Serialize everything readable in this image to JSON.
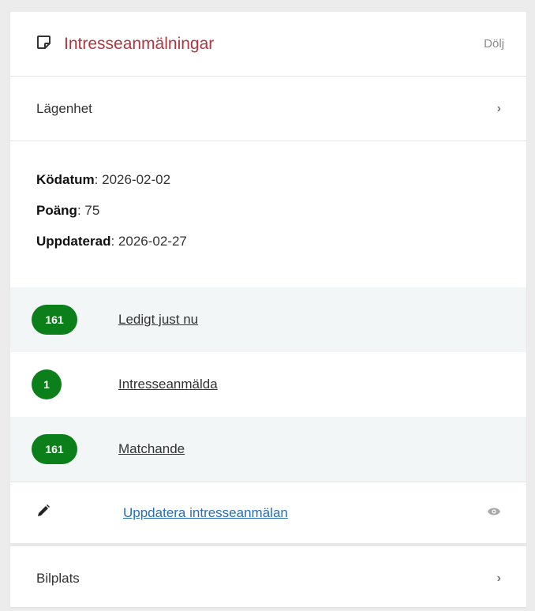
{
  "header": {
    "title": "Intresseanmälningar",
    "hide_label": "Dölj",
    "icon": "note-icon"
  },
  "apartment_row": {
    "label": "Lägenhet",
    "chevron": "›"
  },
  "info": {
    "queue_date_label": "Ködatum",
    "queue_date_value": ": 2026-02-02",
    "points_label": "Poäng",
    "points_value": ": 75",
    "updated_label": "Uppdaterad",
    "updated_value": ": 2026-02-27"
  },
  "stats": [
    {
      "count": "161",
      "label": "Ledigt just nu"
    },
    {
      "count": "1",
      "label": "Intresseanmälda"
    },
    {
      "count": "161",
      "label": "Matchande"
    }
  ],
  "update_row": {
    "label": "Uppdatera intresseanmälan",
    "icon": "pencil-icon",
    "action_icon": "eye-icon"
  },
  "parking_row": {
    "label": "Bilplats",
    "chevron": "›"
  },
  "colors": {
    "accent": "#b0373f",
    "badge": "#0a7f1a",
    "link": "#2a6fb0"
  }
}
